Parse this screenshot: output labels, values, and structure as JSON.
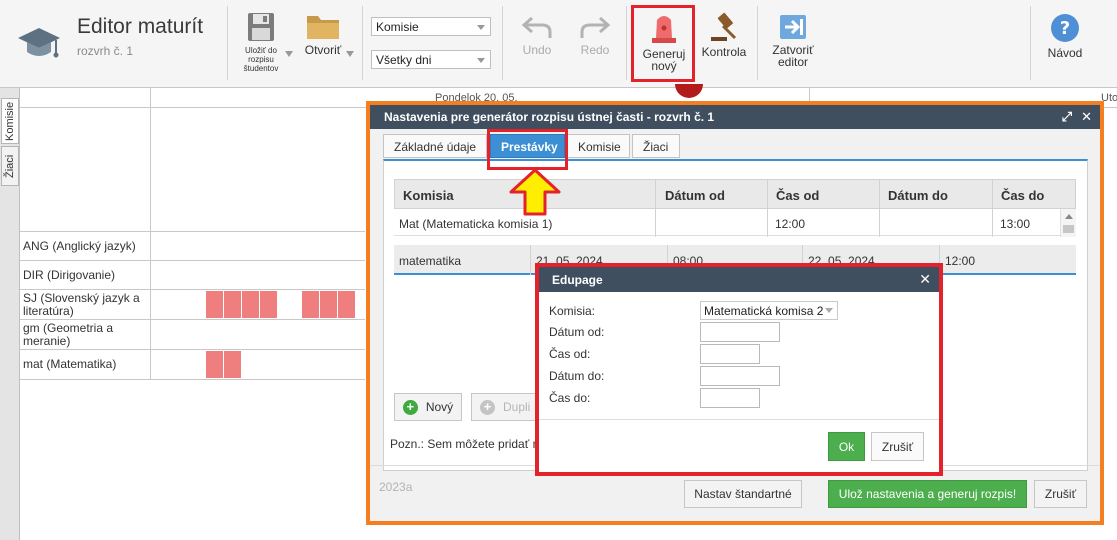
{
  "app": {
    "title": "Editor maturít",
    "subtitle": "rozvrh č. 1"
  },
  "toolbar": {
    "save_label_1": "Uložiť do",
    "save_label_2": "rozpisu",
    "save_label_3": "študentov",
    "open_label": "Otvoriť",
    "filter_commission": "Komisie",
    "filter_days": "Všetky dni",
    "undo_label": "Undo",
    "redo_label": "Redo",
    "generate_label_1": "Generuj",
    "generate_label_2": "nový",
    "check_label": "Kontrola",
    "close_label_1": "Zatvoriť",
    "close_label_2": "editor",
    "help_label": "Návod"
  },
  "side_tabs": {
    "commissions": "Komisie",
    "students": "Žiaci"
  },
  "grid": {
    "day_1": "Pondelok 20. 05.",
    "day_2": "Uto",
    "rows": [
      "ANG (Anglický jazyk)",
      "DIR (Dirigovanie)",
      "SJ (Slovenský jazyk a literatúra)",
      "gm (Geometria a meranie)",
      "mat (Matematika)"
    ]
  },
  "settings_dialog": {
    "title": "Nastavenia pre generátor rozpisu ústnej časti - rozvrh č. 1",
    "tabs": [
      "Základné údaje",
      "Prestávky",
      "Komisie",
      "Žiaci"
    ],
    "columns": [
      "Komisia",
      "Dátum od",
      "Čas od",
      "Dátum do",
      "Čas do"
    ],
    "rows": [
      {
        "komisia": "Mat (Matematicka komisia 1)",
        "datum_od": "",
        "cas_od": "12:00",
        "datum_do": "",
        "cas_do": "13:00"
      }
    ],
    "subrow": {
      "name": "matematika",
      "datum_od": "21. 05. 2024",
      "cas_od": "08:00",
      "datum_do": "22. 05. 2024",
      "cas_do": "12:00"
    },
    "new_button": "Nový",
    "duplicate_button": "Dupli",
    "note": "Pozn.: Sem môžete pridať m",
    "year": "2023a",
    "standard_button": "Nastav štandartné",
    "save_generate_button": "Ulož nastavenia a generuj rozpis!",
    "cancel_button": "Zrušiť"
  },
  "edupage_modal": {
    "title": "Edupage",
    "komisia_label": "Komisia:",
    "komisia_value": "Matematická komisa 2",
    "datum_od_label": "Dátum od:",
    "cas_od_label": "Čas od:",
    "datum_do_label": "Dátum do:",
    "cas_do_label": "Čas do:",
    "ok_button": "Ok",
    "cancel_button": "Zrušiť"
  },
  "colors": {
    "annotation_red": "#e3222b",
    "annotation_orange": "#f47e20",
    "dialog_header": "#3f4f5f",
    "active_tab": "#3c8fd3",
    "primary_green": "#4cae4c",
    "schedule_cell": "#ef7f7f"
  }
}
